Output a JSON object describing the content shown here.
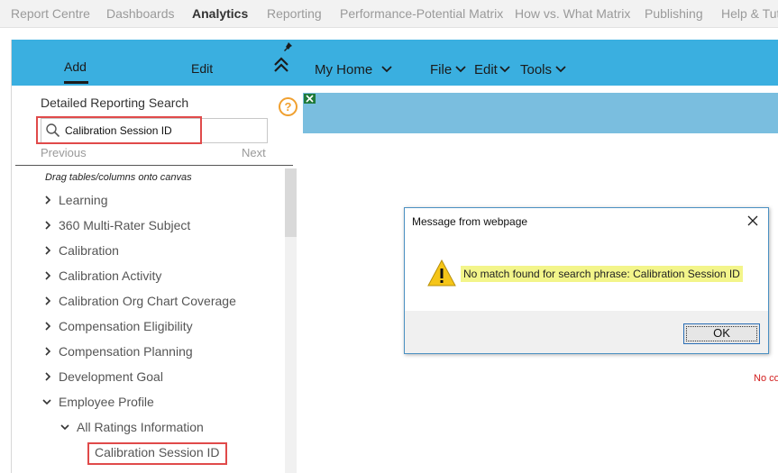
{
  "topnav": {
    "items": [
      {
        "label": "Report Centre",
        "active": false
      },
      {
        "label": "Dashboards",
        "active": false
      },
      {
        "label": "Analytics",
        "active": true
      },
      {
        "label": "Reporting",
        "active": false
      },
      {
        "label": "Performance-Potential Matrix",
        "active": false
      },
      {
        "label": "How vs. What Matrix",
        "active": false
      },
      {
        "label": "Publishing",
        "active": false
      },
      {
        "label": "Help & Tuto",
        "active": false
      }
    ]
  },
  "left_panel": {
    "tabs": {
      "add": "Add",
      "edit": "Edit"
    },
    "search_title": "Detailed Reporting Search",
    "search_value": "Calibration Session ID",
    "previous": "Previous",
    "next": "Next",
    "drag_hint": "Drag tables/columns onto canvas",
    "tree": [
      {
        "label": "Learning",
        "expanded": false
      },
      {
        "label": "360 Multi-Rater Subject",
        "expanded": false
      },
      {
        "label": "Calibration",
        "expanded": false
      },
      {
        "label": "Calibration Activity",
        "expanded": false
      },
      {
        "label": "Calibration Org Chart Coverage",
        "expanded": false
      },
      {
        "label": "Compensation Eligibility",
        "expanded": false
      },
      {
        "label": "Compensation Planning",
        "expanded": false
      },
      {
        "label": "Development Goal",
        "expanded": false
      },
      {
        "label": "Employee Profile",
        "expanded": true
      },
      {
        "label": "All Ratings Information",
        "expanded": true
      },
      {
        "label": "Calibration Session ID",
        "leaf": true
      }
    ]
  },
  "main": {
    "menu": {
      "my_home": "My Home",
      "file": "File",
      "edit": "Edit",
      "tools": "Tools"
    },
    "no_count_text": "No co"
  },
  "dialog": {
    "title": "Message from webpage",
    "message": "No match found for search phrase: Calibration Session ID",
    "ok_label": "OK"
  },
  "colors": {
    "header_blue": "#3aafe0",
    "canvas_bar": "#7abedf",
    "highlight_red": "#e04a4a",
    "message_highlight": "#f3f58a",
    "help_orange": "#f0a030"
  }
}
